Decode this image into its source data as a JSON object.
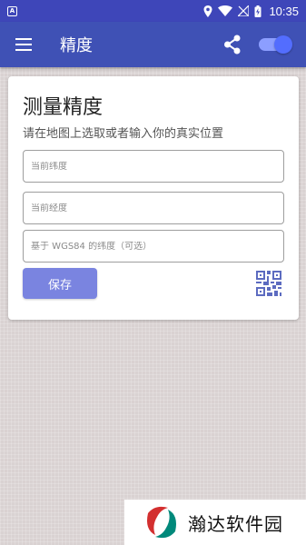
{
  "status_bar": {
    "time": "10:35",
    "icons": [
      "location-icon",
      "wifi-icon",
      "no-signal-icon",
      "battery-charging-icon"
    ]
  },
  "app_bar": {
    "title": "精度",
    "icons": [
      "menu-icon",
      "share-icon"
    ],
    "toggle_on": true
  },
  "card": {
    "title": "测量精度",
    "subtitle": "请在地图上选取或者输入你的真实位置",
    "fields": [
      {
        "placeholder": "当前纬度",
        "value": ""
      },
      {
        "placeholder": "当前经度",
        "value": ""
      },
      {
        "placeholder": "基于 WGS84 的纬度（可选）",
        "value": ""
      }
    ],
    "save_label": "保存",
    "qr_icon": "qr-code-icon"
  },
  "colors": {
    "app_bar": "#3f51b5",
    "status_bar": "#3e46b9",
    "button": "#7a84e0",
    "accent": "#536dfe",
    "qr": "#5c6bc0"
  },
  "watermark": {
    "text": "瀚达软件园"
  }
}
